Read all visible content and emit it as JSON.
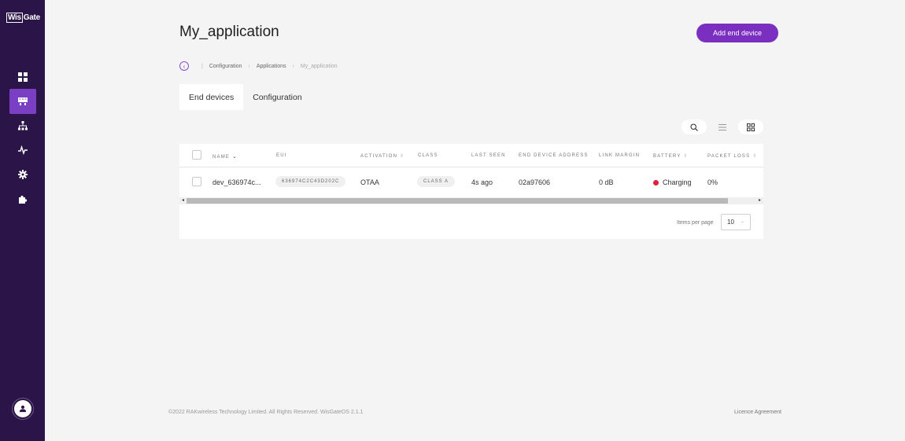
{
  "app": {
    "logo_boxed": "Wis",
    "logo_rest": "Gate"
  },
  "sidebar": {
    "items": [
      {
        "name": "dashboard",
        "icon": "grid-icon",
        "active": false
      },
      {
        "name": "end-devices",
        "icon": "device-icon",
        "active": true
      },
      {
        "name": "network",
        "icon": "network-icon",
        "active": false
      },
      {
        "name": "activity",
        "icon": "pulse-icon",
        "active": false
      },
      {
        "name": "settings",
        "icon": "gear-icon",
        "active": false
      },
      {
        "name": "extensions",
        "icon": "puzzle-icon",
        "active": false
      }
    ],
    "avatar_icon": "user-icon"
  },
  "header": {
    "title": "My_application",
    "add_button_label": "Add end device"
  },
  "breadcrumb": {
    "back_icon": "chevron-left-icon",
    "items": [
      "Configuration",
      "Applications",
      "My_application"
    ]
  },
  "tabs": [
    {
      "label": "End devices",
      "active": true
    },
    {
      "label": "Configuration",
      "active": false
    }
  ],
  "toolbar": {
    "search_icon": "search-icon",
    "list_icon": "list-view-icon",
    "grid_icon": "grid-view-icon"
  },
  "table": {
    "columns": [
      {
        "label": "NAME",
        "sort": "chevron-down"
      },
      {
        "label": "EUI",
        "sort": ""
      },
      {
        "label": "ACTIVATION",
        "sort": "sortable"
      },
      {
        "label": "CLASS",
        "sort": ""
      },
      {
        "label": "LAST SEEN",
        "sort": ""
      },
      {
        "label": "END DEVICE ADDRESS",
        "sort": ""
      },
      {
        "label": "LINK MARGIN",
        "sort": ""
      },
      {
        "label": "BATTERY",
        "sort": "sortable"
      },
      {
        "label": "PACKET LOSS",
        "sort": "sortable"
      }
    ],
    "rows": [
      {
        "name": "dev_636974c...",
        "eui": "636974C2C43D202C",
        "activation": "OTAA",
        "class": "CLASS A",
        "last_seen": "4s ago",
        "address": "02a97606",
        "link_margin": "0 dB",
        "battery": "Charging",
        "battery_color": "#e0213d",
        "packet_loss": "0%"
      }
    ]
  },
  "pagination": {
    "label": "Items per page",
    "value": "10"
  },
  "footer": {
    "copyright": "©2022 RAKwireless Technology Limited. All Rights Reserved. WisGateOS 2.1.1",
    "licence_link": "Licence Agreement"
  },
  "colors": {
    "sidebar_bg": "#2b1548",
    "accent": "#7b2fc0",
    "active_nav": "#7b3fc4"
  }
}
